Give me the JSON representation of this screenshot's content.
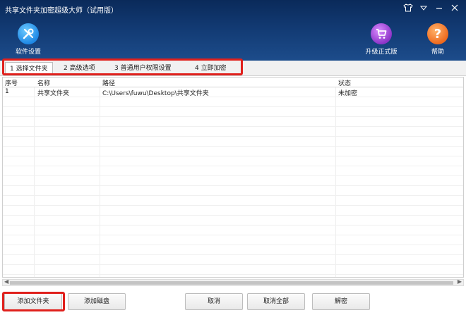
{
  "window": {
    "title": "共享文件夹加密超级大师（试用版）"
  },
  "toolbar": {
    "settings_label": "软件设置",
    "upgrade_label": "升级正式版",
    "help_label": "帮助"
  },
  "tabs": [
    {
      "label": "1 选择文件夹",
      "active": true
    },
    {
      "label": "2 高级选项",
      "active": false
    },
    {
      "label": "3 普通用户权限设置",
      "active": false
    },
    {
      "label": "4 立即加密",
      "active": false
    }
  ],
  "table": {
    "headers": {
      "no": "序号",
      "name": "名称",
      "path": "路径",
      "status": "状态"
    },
    "rows": [
      {
        "no": "1",
        "name": "共享文件夹",
        "path": "C:\\Users\\fuwu\\Desktop\\共享文件夹",
        "status": "未加密"
      }
    ]
  },
  "buttons": {
    "add_folder": "添加文件夹",
    "add_disk": "添加磁盘",
    "cancel": "取消",
    "cancel_all": "取消全部",
    "decrypt": "解密"
  },
  "colors": {
    "highlight": "#e0201c",
    "topbar": "#123a73"
  }
}
